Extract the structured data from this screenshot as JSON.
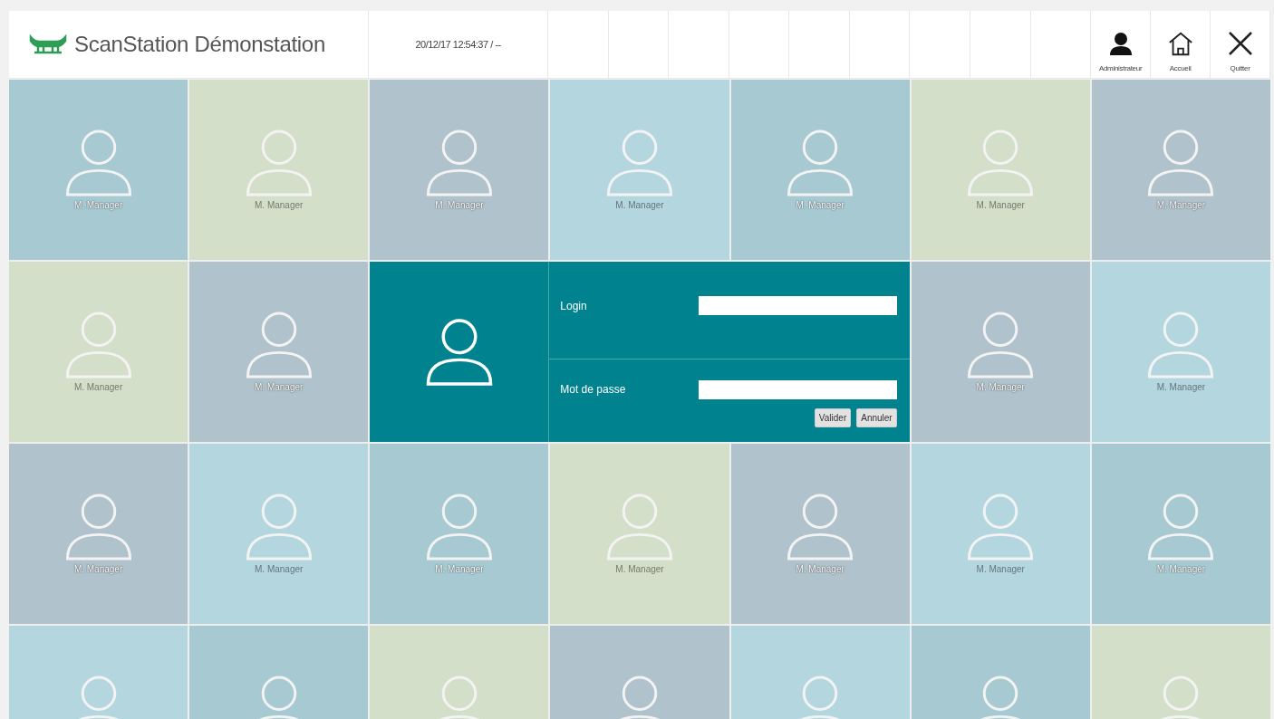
{
  "header": {
    "app_title": "ScanStation Démonstation",
    "datetime": "20/12/17 12:54:37 / --",
    "buttons": [
      {
        "kind": "user",
        "label": "Administrateur"
      },
      {
        "kind": "home",
        "label": "Accueil"
      },
      {
        "kind": "close",
        "label": "Quitter"
      }
    ]
  },
  "grid": [
    {
      "kind": "user",
      "name": "M. Manager",
      "color": "#a6c9d2"
    },
    {
      "kind": "user",
      "name": "M. Manager",
      "color": "#d3dfc8"
    },
    {
      "kind": "user",
      "name": "M. Manager",
      "color": "#b0c2cb"
    },
    {
      "kind": "user",
      "name": "M. Manager",
      "color": "#b4d7df"
    },
    {
      "kind": "user",
      "name": "M. Manager",
      "color": "#a6c9d2"
    },
    {
      "kind": "user",
      "name": "M. Manager",
      "color": "#d3dfc8"
    },
    {
      "kind": "user",
      "name": "M. Manager",
      "color": "#b0c2cb"
    },
    {
      "kind": "user",
      "name": "M. Manager",
      "color": "#d3dfc8"
    },
    {
      "kind": "user",
      "name": "M. Manager",
      "color": "#b0c2cb"
    },
    {
      "kind": "login",
      "login_label": "Login",
      "password_label": "Mot de passe",
      "buttons": [
        "Valider",
        "Annuler"
      ]
    },
    {
      "kind": "user",
      "name": "M. Manager",
      "color": "#b0c2cb"
    },
    {
      "kind": "user",
      "name": "M. Manager",
      "color": "#b4d7df"
    },
    {
      "kind": "user",
      "name": "M. Manager",
      "color": "#b0c2cb"
    },
    {
      "kind": "user",
      "name": "M. Manager",
      "color": "#b4d7df"
    },
    {
      "kind": "user",
      "name": "M. Manager",
      "color": "#a6c9d2"
    },
    {
      "kind": "user",
      "name": "M. Manager",
      "color": "#d3dfc8"
    },
    {
      "kind": "user",
      "name": "M. Manager",
      "color": "#b0c2cb"
    },
    {
      "kind": "user",
      "name": "M. Manager",
      "color": "#b4d7df"
    },
    {
      "kind": "user",
      "name": "M. Manager",
      "color": "#a6c9d2"
    },
    {
      "kind": "user",
      "color": "#b4d7df"
    },
    {
      "kind": "user",
      "color": "#a6c9d2"
    },
    {
      "kind": "user",
      "color": "#d3dfc8"
    },
    {
      "kind": "user",
      "color": "#b0c2cb"
    },
    {
      "kind": "user",
      "color": "#b4d7df"
    },
    {
      "kind": "user",
      "color": "#a6c9d2"
    },
    {
      "kind": "user",
      "color": "#d3dfc8"
    }
  ]
}
